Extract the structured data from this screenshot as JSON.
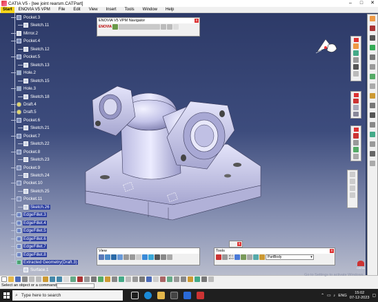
{
  "window": {
    "title": "CATIA V5 - [tee joint rearsm.CATPart]"
  },
  "menu": [
    "Start",
    "ENOVIA V5 VPM",
    "File",
    "Edit",
    "View",
    "Insert",
    "Tools",
    "Window",
    "Help"
  ],
  "tree": [
    {
      "label": "Pocket.3",
      "type": "pocket",
      "indent": 0,
      "sel": false
    },
    {
      "label": "Sketch.11",
      "type": "sketch",
      "indent": 1,
      "sel": false
    },
    {
      "label": "Mirror.2",
      "type": "sketch",
      "indent": 0,
      "sel": false
    },
    {
      "label": "Pocket.4",
      "type": "pocket",
      "indent": 0,
      "sel": false
    },
    {
      "label": "Sketch.12",
      "type": "sketch",
      "indent": 1,
      "sel": false
    },
    {
      "label": "Pocket.5",
      "type": "pocket",
      "indent": 0,
      "sel": false
    },
    {
      "label": "Sketch.13",
      "type": "sketch",
      "indent": 1,
      "sel": false
    },
    {
      "label": "Hole.2",
      "type": "hole",
      "indent": 0,
      "sel": false
    },
    {
      "label": "Sketch.15",
      "type": "sketch",
      "indent": 1,
      "sel": false
    },
    {
      "label": "Hole.3",
      "type": "hole",
      "indent": 0,
      "sel": false
    },
    {
      "label": "Sketch.18",
      "type": "sketch",
      "indent": 1,
      "sel": false
    },
    {
      "label": "Draft.4",
      "type": "draft",
      "indent": 0,
      "sel": false
    },
    {
      "label": "Draft.5",
      "type": "draft",
      "indent": 0,
      "sel": false
    },
    {
      "label": "Pocket.6",
      "type": "pocket",
      "indent": 0,
      "sel": false
    },
    {
      "label": "Sketch.21",
      "type": "sketch",
      "indent": 1,
      "sel": false
    },
    {
      "label": "Pocket.7",
      "type": "pocket",
      "indent": 0,
      "sel": false
    },
    {
      "label": "Sketch.22",
      "type": "sketch",
      "indent": 1,
      "sel": false
    },
    {
      "label": "Pocket.8",
      "type": "pocket",
      "indent": 0,
      "sel": false
    },
    {
      "label": "Sketch.23",
      "type": "sketch",
      "indent": 1,
      "sel": false
    },
    {
      "label": "Pocket.9",
      "type": "pocket",
      "indent": 0,
      "sel": false
    },
    {
      "label": "Sketch.24",
      "type": "sketch",
      "indent": 1,
      "sel": false
    },
    {
      "label": "Pocket.10",
      "type": "pocket",
      "indent": 0,
      "sel": false
    },
    {
      "label": "Sketch.25",
      "type": "sketch",
      "indent": 1,
      "sel": false
    },
    {
      "label": "Pocket.11",
      "type": "pocket",
      "indent": 0,
      "sel": false
    },
    {
      "label": "Sketch.26",
      "type": "sketch",
      "indent": 1,
      "sel": true
    },
    {
      "label": "EdgeFillet.3",
      "type": "fillet",
      "indent": 0,
      "sel": true
    },
    {
      "label": "EdgeFillet.4",
      "type": "fillet",
      "indent": 0,
      "sel": true
    },
    {
      "label": "EdgeFillet.5",
      "type": "fillet",
      "indent": 0,
      "sel": true
    },
    {
      "label": "EdgeFillet.6",
      "type": "fillet",
      "indent": 0,
      "sel": true
    },
    {
      "label": "EdgeFillet.7",
      "type": "fillet",
      "indent": 0,
      "sel": true
    },
    {
      "label": "EdgeFillet.8",
      "type": "fillet",
      "indent": 0,
      "sel": true
    },
    {
      "label": "Extracted Geometry(Draft.3)",
      "type": "extract",
      "indent": 0,
      "sel": true
    },
    {
      "label": "Surface.1",
      "type": "sketch",
      "indent": 1,
      "sel": false
    }
  ],
  "navigator": {
    "title": "ENOVIA V5 VPM Navigator",
    "brand": "ENOVIA"
  },
  "view_toolbar": {
    "title": "View"
  },
  "tools_toolbar": {
    "title": "Tools",
    "scale_top": "10.1",
    "scale_bottom": "10.0",
    "body_value": "PartBody"
  },
  "status": {
    "message": "Select an object or a command",
    "watermark": "Go to Settings to activate Windows."
  },
  "taskbar": {
    "search_placeholder": "Type here to search",
    "lang": "ENG",
    "time": "15:02",
    "date": "07-12-2023"
  },
  "brand": {
    "catia": "CATIA"
  }
}
